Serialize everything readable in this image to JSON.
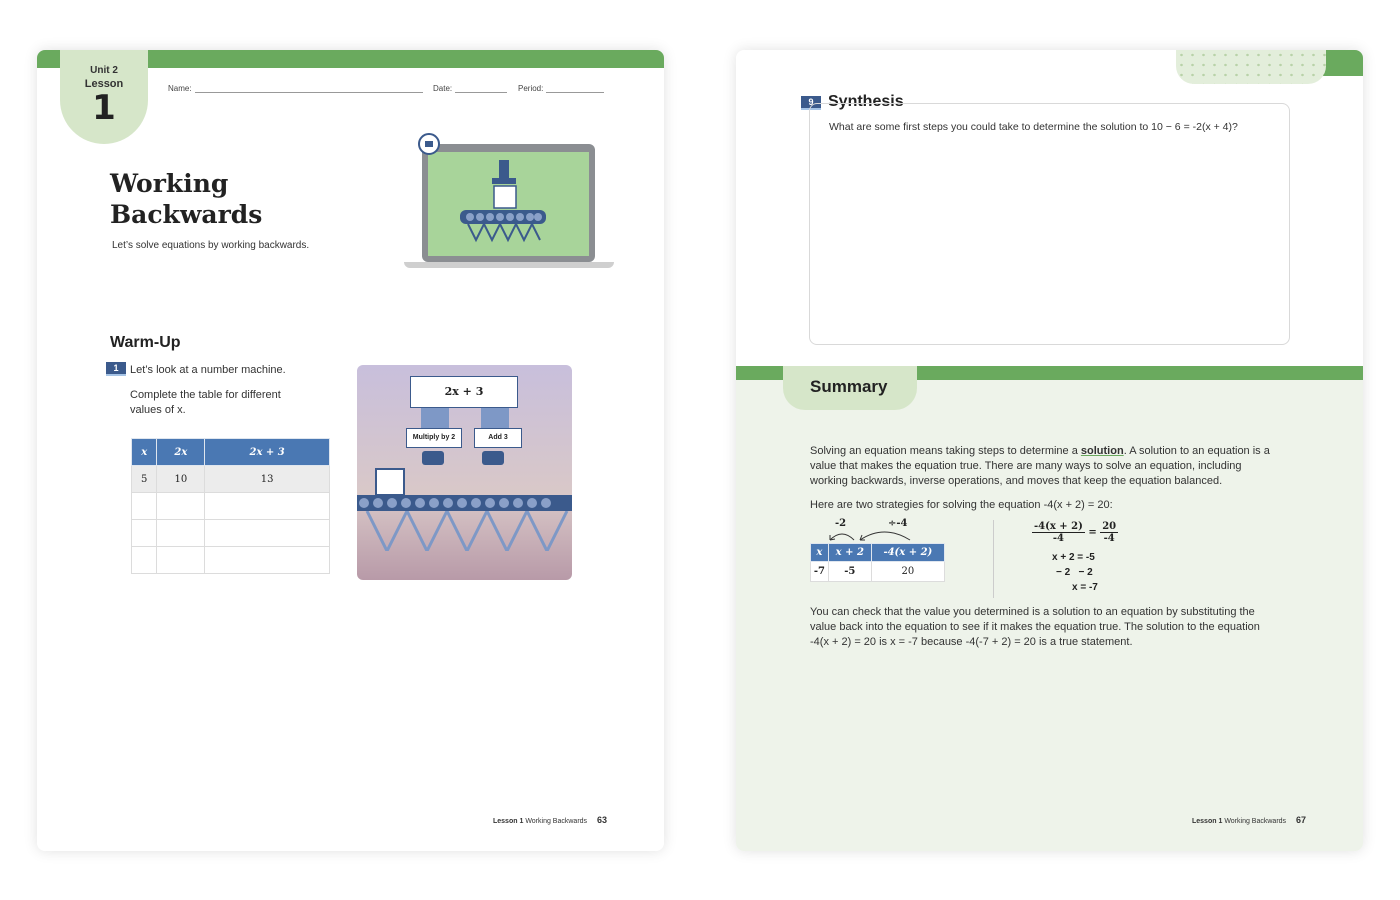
{
  "left_page": {
    "unit": "Unit 2",
    "lesson_label": "Lesson",
    "lesson_number": "1",
    "header": {
      "name": "Name:",
      "date": "Date:",
      "period": "Period:"
    },
    "title_line1": "Working",
    "title_line2": "Backwards",
    "subtitle": "Let’s solve equations by working backwards.",
    "warmup_heading": "Warm-Up",
    "q1_number": "1",
    "q1_text": "Let’s look at a number machine.",
    "q1_instruction": "Complete the table for different values of x.",
    "table": {
      "headers": [
        "x",
        "2x",
        "2x + 3"
      ],
      "rows": [
        [
          "5",
          "10",
          "13"
        ],
        [
          "",
          "",
          ""
        ],
        [
          "",
          "",
          ""
        ],
        [
          "",
          "",
          ""
        ]
      ]
    },
    "machine": {
      "expression": "2x + 3",
      "step1": "Multiply by 2",
      "step2": "Add 3"
    },
    "footer": {
      "lesson": "Lesson 1",
      "title": "Working Backwards",
      "page": "63"
    }
  },
  "right_page": {
    "q9_number": "9",
    "synthesis_heading": "Synthesis",
    "synthesis_question": "What are some first steps you could take to determine the solution to 10 − 6 = -2(x + 4)?",
    "summary_heading": "Summary",
    "summary_p1_pre": "Solving an equation means taking steps to determine a ",
    "summary_p1_term": "solution",
    "summary_p1_post": ". A solution to an equation is a value that makes the equation true. There are many ways to solve an equation, including working backwards, inverse operations, and moves that keep the equation balanced.",
    "summary_p2": "Here are two strategies for solving the equation -4(x + 2) = 20:",
    "strategy_table": {
      "op1": "-2",
      "op2": "÷-4",
      "headers": [
        "x",
        "x + 2",
        "-4(x + 2)"
      ],
      "row": [
        "-7",
        "-5",
        "20"
      ]
    },
    "strategy_equations": {
      "frac_left_num": "-4(x + 2)",
      "frac_left_den": "-4",
      "frac_eq": "=",
      "frac_right_num": "20",
      "frac_right_den": "-4",
      "line2": "x + 2 = -5",
      "line3": "− 2   − 2",
      "line4": "x = -7"
    },
    "summary_p3": "You can check that the value you determined is a solution to an equation by substituting the value back into the equation to see if it makes the equation true. The solution to the equation -4(x + 2) = 20 is x = -7 because -4(-7 + 2) = 20 is a true statement.",
    "footer": {
      "lesson": "Lesson 1",
      "title": "Working Backwards",
      "page": "67"
    }
  }
}
